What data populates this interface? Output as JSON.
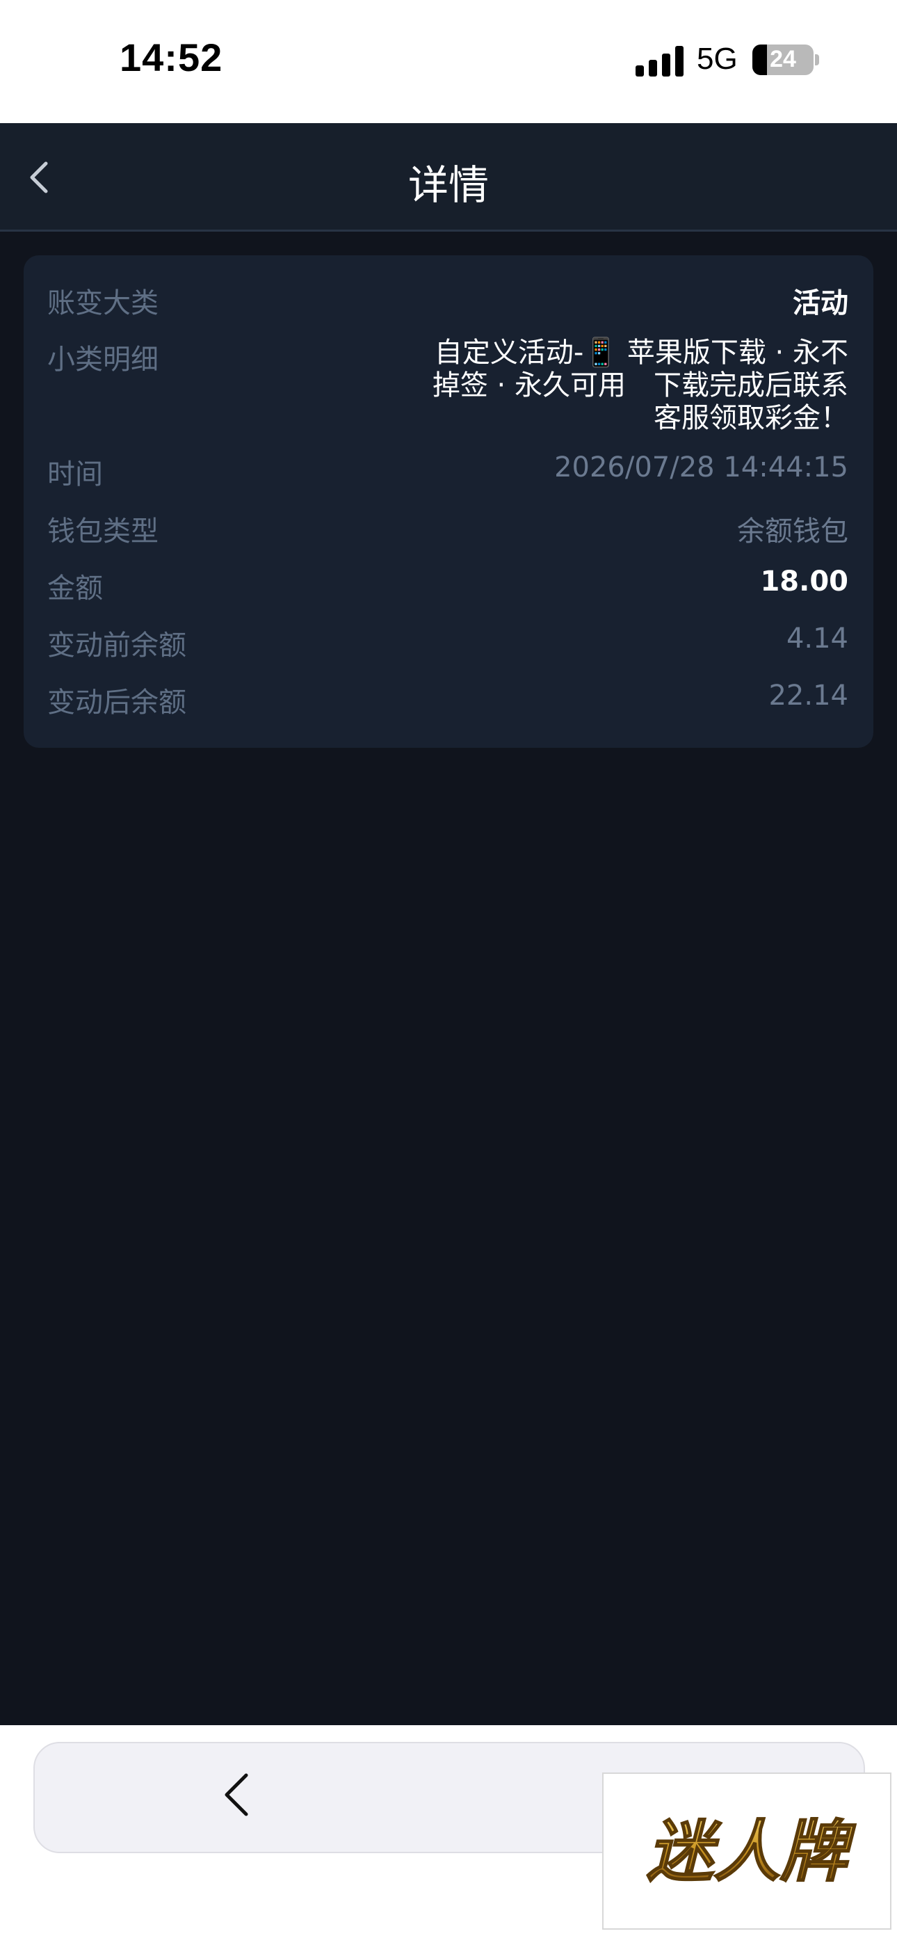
{
  "status_bar": {
    "time": "14:52",
    "network": "5G",
    "battery": "24",
    "battery_level": 0.24
  },
  "header": {
    "title": "详情",
    "back_icon": "chevron-left-icon"
  },
  "details": [
    {
      "label": "账变大类",
      "value": "活动"
    },
    {
      "label": "小类明细",
      "value": "自定义活动-📱 苹果版下载 · 永不掉签 · 永久可用　下载完成后联系客服领取彩金！"
    },
    {
      "label": "时间",
      "value": "2026/07/28 14:44:15"
    },
    {
      "label": "钱包类型",
      "value": "余额钱包"
    },
    {
      "label": "金额",
      "value": "18.00"
    },
    {
      "label": "变动前余额",
      "value": "4.14"
    },
    {
      "label": "变动后余额",
      "value": "22.14"
    }
  ],
  "browser_bar": {
    "back_icon": "chevron-left-icon"
  },
  "watermark": {
    "text": "迷人牌"
  },
  "colors": {
    "app_bg": "#10141d",
    "nav_bg": "#171f2b",
    "card_bg": "#182130",
    "label": "#5f6f85",
    "gold": "#c9931f"
  }
}
